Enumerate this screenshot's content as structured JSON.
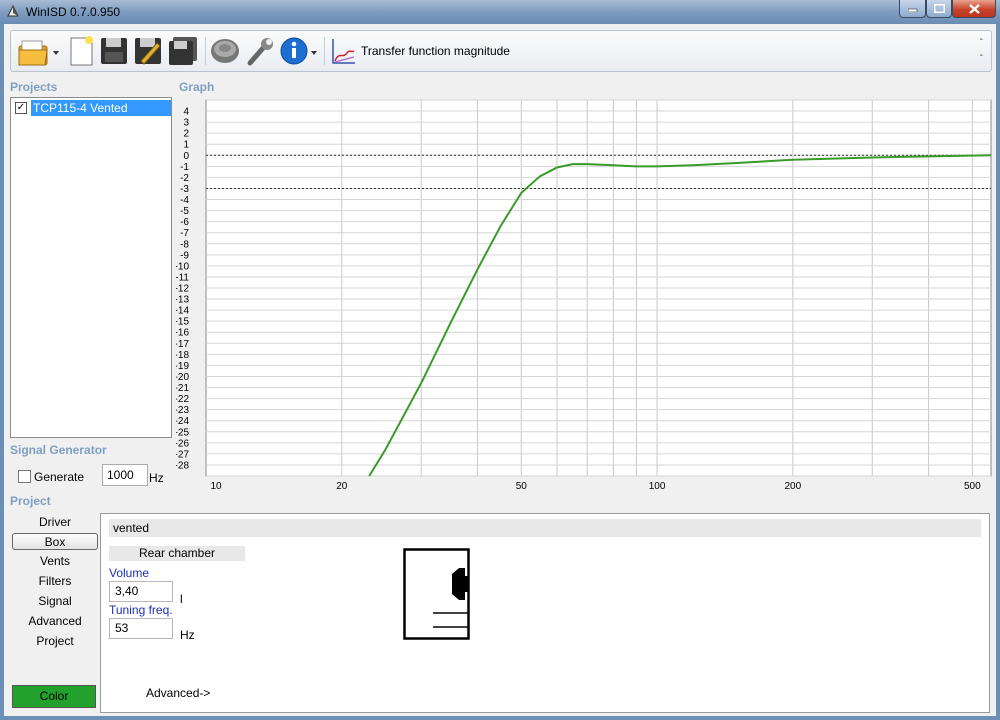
{
  "window": {
    "title": "WinISD 0.7.0.950"
  },
  "toolbar": {
    "open_icon": "folder-open-icon",
    "view_title": "Transfer function magnitude",
    "right_dashes": [
      "-",
      "-"
    ]
  },
  "sections": {
    "projects": "Projects",
    "graph": "Graph",
    "signal_generator": "Signal Generator",
    "project": "Project"
  },
  "projects": {
    "items": [
      {
        "name": "TCP115-4 Vented",
        "checked": true,
        "check_mark": "✓"
      }
    ]
  },
  "signal_generator": {
    "generate_label": "Generate",
    "frequency": "1000",
    "unit": "Hz"
  },
  "project_nav": {
    "items": [
      "Driver",
      "Box",
      "Vents",
      "Filters",
      "Signal",
      "Advanced",
      "Project"
    ],
    "selected": "Box",
    "color_label": "Color",
    "color": "#22a12d"
  },
  "box": {
    "type": "vented",
    "chamber_label": "Rear chamber",
    "volume_label": "Volume",
    "volume_value": "3,40",
    "volume_unit": "l",
    "tuning_label": "Tuning freq.",
    "tuning_value": "53",
    "tuning_unit": "Hz",
    "advanced_label": "Advanced->"
  },
  "chart_data": {
    "type": "line",
    "scale_x": "log",
    "xlim": [
      10,
      550
    ],
    "ylim": [
      -29,
      5
    ],
    "x_tick_labels": [
      "10",
      "20",
      "50",
      "100",
      "200",
      "500"
    ],
    "y_tick_labels": [
      "4",
      "3",
      "2",
      "1",
      "0",
      "-1",
      "-2",
      "-3",
      "-4",
      "-5",
      "-6",
      "-7",
      "-8",
      "-9",
      "-10",
      "-11",
      "-12",
      "-13",
      "-14",
      "-15",
      "-16",
      "-17",
      "-18",
      "-19",
      "-20",
      "-21",
      "-22",
      "-23",
      "-24",
      "-25",
      "-26",
      "-27",
      "-28"
    ],
    "reference_lines": [
      0,
      -3
    ],
    "grid": true,
    "series": [
      {
        "color": "#3a9a2a",
        "x": [
          23,
          25,
          30,
          35,
          40,
          45,
          50,
          55,
          60,
          65,
          70,
          80,
          90,
          100,
          120,
          150,
          200,
          300,
          400,
          550
        ],
        "y": [
          -29,
          -26.6,
          -20.6,
          -15.0,
          -10.3,
          -6.4,
          -3.4,
          -1.9,
          -1.1,
          -0.8,
          -0.8,
          -0.9,
          -1.0,
          -1.0,
          -0.9,
          -0.7,
          -0.4,
          -0.2,
          -0.1,
          0.0
        ]
      }
    ]
  }
}
